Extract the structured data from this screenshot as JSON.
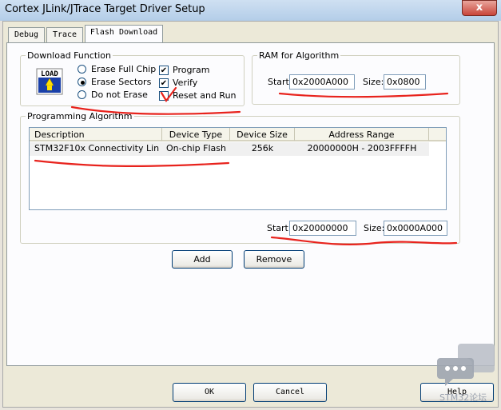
{
  "window": {
    "title": "Cortex JLink/JTrace Target Driver Setup",
    "close_glyph": "x"
  },
  "tabs": [
    {
      "label": "Debug"
    },
    {
      "label": "Trace"
    },
    {
      "label": "Flash Download"
    }
  ],
  "download_function": {
    "legend": "Download Function",
    "icon_text": "LOAD",
    "erase_options": [
      {
        "label": "Erase Full Chip",
        "selected": false
      },
      {
        "label": "Erase Sectors",
        "selected": true
      },
      {
        "label": "Do not Erase",
        "selected": false
      }
    ],
    "checks": [
      {
        "label": "Program",
        "checked": true
      },
      {
        "label": "Verify",
        "checked": true
      },
      {
        "label": "Reset and Run",
        "checked": true
      }
    ]
  },
  "ram": {
    "legend": "RAM for Algorithm",
    "start_label": "Start:",
    "start_value": "0x2000A000",
    "size_label": "Size:",
    "size_value": "0x0800"
  },
  "programming": {
    "legend": "Programming Algorithm",
    "columns": [
      "Description",
      "Device Type",
      "Device Size",
      "Address Range"
    ],
    "rows": [
      {
        "description": "STM32F10x Connectivity Lin...",
        "device_type": "On-chip Flash",
        "device_size": "256k",
        "address_range": "20000000H - 2003FFFFH"
      }
    ],
    "start_label": "Start:",
    "start_value": "0x20000000",
    "size_label": "Size:",
    "size_value": "0x0000A000"
  },
  "buttons": {
    "add": "Add",
    "remove": "Remove",
    "ok": "OK",
    "cancel": "Cancel",
    "help": "Help"
  },
  "watermark": {
    "text": "STM32论坛"
  },
  "colors": {
    "annotation_red": "#e8231d",
    "titlebar": "#b3cde8",
    "dialog_bg": "#ece9d8"
  }
}
